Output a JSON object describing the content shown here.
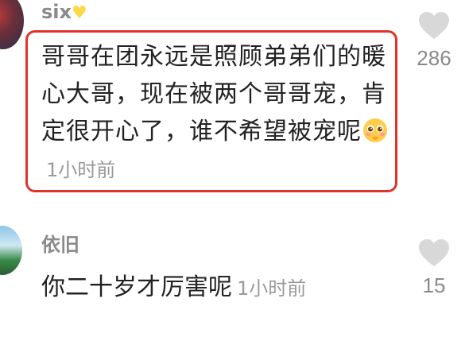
{
  "comments": [
    {
      "username": "six",
      "username_emoji_icon": "yellow-heart-icon",
      "text": "哥哥在团永远是照顾弟弟们的暖心大哥，现在被两个哥哥宠，肯定很开心了，谁不希望被宠呢",
      "inline_emoji_icon": "pleading-face-icon",
      "time": "1小时前",
      "likes": "286"
    },
    {
      "username": "依旧",
      "text": "你二十岁才厉害呢",
      "time": "1小时前",
      "likes": "15"
    }
  ],
  "colors": {
    "highlight_border": "#e0322c",
    "meta_gray": "#9a9a9a",
    "heart_gray": "#d8d8d8"
  }
}
